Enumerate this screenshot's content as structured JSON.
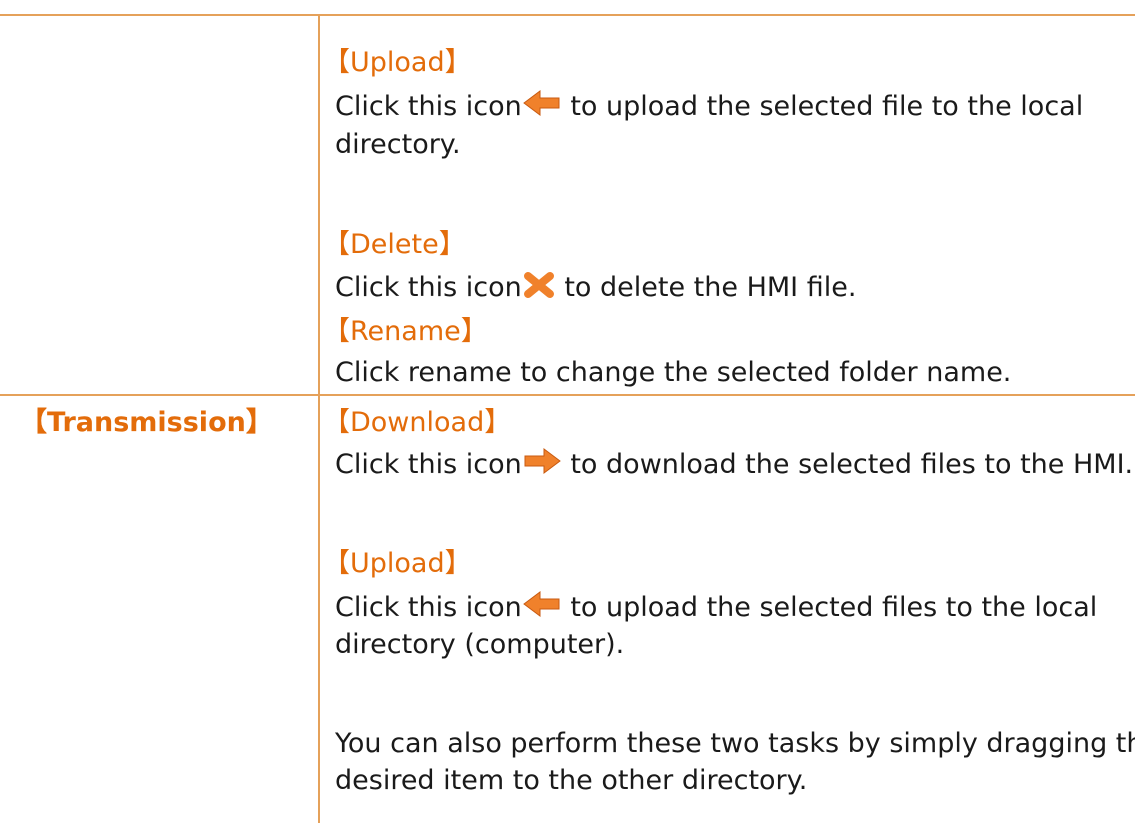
{
  "rows": [
    {
      "label": "",
      "sections": [
        {
          "heading": "【Upload】",
          "prefix": "Click this icon",
          "icon": "arrow-left-icon",
          "line1_rest": "to upload the selected file to the local",
          "line2": "directory."
        },
        {
          "heading": "【Delete】",
          "prefix": "Click this icon",
          "icon": "delete-x-icon",
          "line1_rest": "to delete the HMI file."
        },
        {
          "heading": "【Rename】",
          "text": "Click rename to change the selected folder name."
        }
      ]
    },
    {
      "label": "【Transmission】",
      "sections": [
        {
          "heading": "【Download】",
          "prefix": "Click this icon",
          "icon": "arrow-right-icon",
          "line1_rest": "to download the selected files to the HMI."
        },
        {
          "heading": "【Upload】",
          "prefix": "Click this icon",
          "icon": "arrow-left-icon",
          "line1_rest": "to upload the selected files to the local",
          "line2": "directory (computer)."
        },
        {
          "text_line1": "You can also perform these two tasks by simply dragging the",
          "text_line2": "desired item to the other directory."
        }
      ]
    }
  ],
  "colors": {
    "border": "#e5a15a",
    "heading": "#e36c0a",
    "icon_orange": "#f0812b"
  }
}
